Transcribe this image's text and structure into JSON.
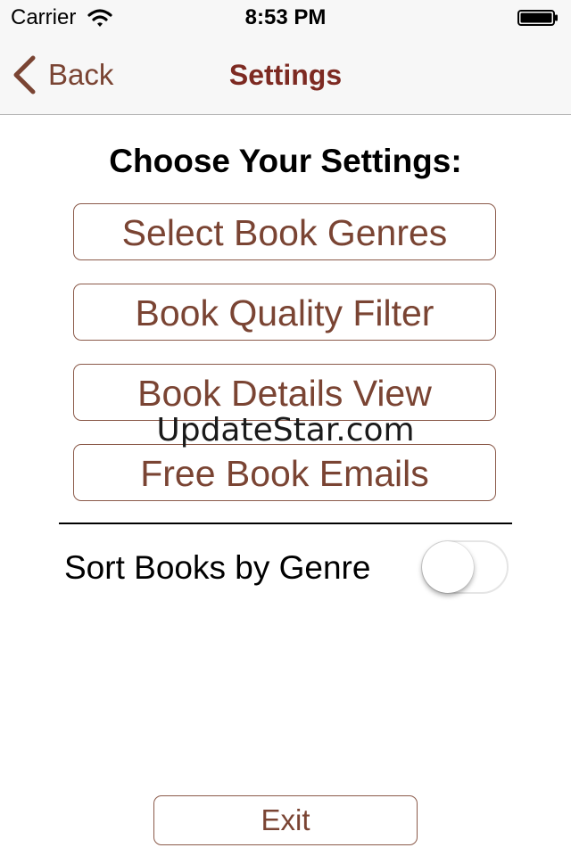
{
  "status_bar": {
    "carrier": "Carrier",
    "time": "8:53 PM",
    "wifi_icon": "wifi-icon",
    "battery_icon": "battery-icon"
  },
  "nav": {
    "back_label": "Back",
    "title": "Settings",
    "back_icon": "chevron-left-icon"
  },
  "main": {
    "heading": "Choose Your Settings:",
    "buttons": [
      {
        "label": "Select Book Genres"
      },
      {
        "label": "Book Quality Filter"
      },
      {
        "label": "Book Details View"
      },
      {
        "label": "Free Book Emails"
      }
    ],
    "watermark": "UpdateStar.com",
    "toggle": {
      "label": "Sort Books by Genre",
      "on": false
    },
    "exit_label": "Exit"
  },
  "colors": {
    "accent": "#7a4433",
    "title": "#7d2a22",
    "bar_background": "#f7f7f7"
  }
}
